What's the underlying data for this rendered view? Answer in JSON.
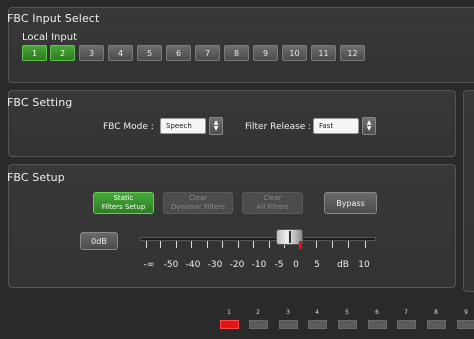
{
  "input_select": {
    "title": "FBC Input Select",
    "label": "Local Input",
    "channels": [
      "1",
      "2",
      "3",
      "4",
      "5",
      "6",
      "7",
      "8",
      "9",
      "10",
      "11",
      "12"
    ],
    "selected": [
      "1",
      "2"
    ]
  },
  "setting": {
    "title": "FBC Setting",
    "mode_label": "FBC Mode :",
    "mode_value": "Speech",
    "release_label": "Filter Release :",
    "release_value": "Fast",
    "spin_up": "▲",
    "spin_down": "▼"
  },
  "setup": {
    "title": "FBC Setup",
    "static_line1": "Static",
    "static_line2": "Filters Setup",
    "clear_dyn_line1": "Clear",
    "clear_dyn_line2": "Dynamic Filters",
    "clear_all_line1": "Clear",
    "clear_all_line2": "All Filters",
    "bypass": "Bypass",
    "gain_value": "0dB",
    "scale_labels": [
      "-∞",
      "-50",
      "-40",
      "-30",
      "-20",
      "-10",
      "-5",
      "0",
      "5",
      "dB",
      "10"
    ],
    "fader_level_db": -2
  },
  "channel_strip": {
    "numbers": [
      "1",
      "2",
      "3",
      "4",
      "5",
      "6",
      "7",
      "8",
      "9"
    ],
    "active": "1"
  },
  "colors": {
    "accent_green": "#3b9a2e",
    "active_red": "#e41414"
  }
}
